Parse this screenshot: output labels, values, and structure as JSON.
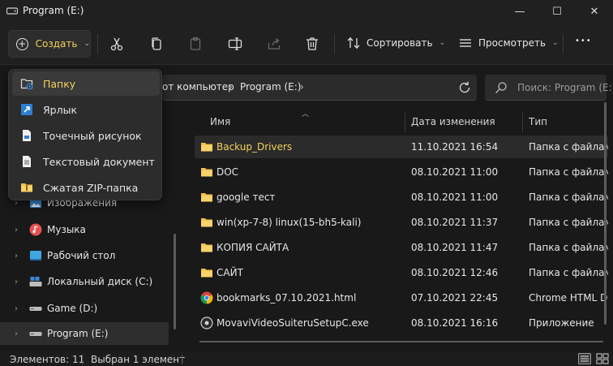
{
  "window": {
    "title": "Program (E:)",
    "minimize": "—",
    "maximize": "☐",
    "close": "✕"
  },
  "toolbar": {
    "create_label": "Создать",
    "sort_label": "Сортировать",
    "view_label": "Просмотреть",
    "more": "•••"
  },
  "dropdown": {
    "items": [
      {
        "label": "Папку",
        "icon": "new-folder-icon"
      },
      {
        "label": "Ярлык",
        "icon": "shortcut-icon"
      },
      {
        "label": "Точечный рисунок",
        "icon": "bitmap-icon"
      },
      {
        "label": "Текстовый документ",
        "icon": "text-document-icon"
      },
      {
        "label": "Сжатая ZIP-папка",
        "icon": "zip-folder-icon"
      }
    ]
  },
  "address": {
    "crumb1": "от компьютер",
    "crumb2": "Program (E:)",
    "sep": "›"
  },
  "search": {
    "placeholder": "Поиск: Program (E:)"
  },
  "nav": {
    "items": [
      {
        "label": "Изображения",
        "icon": "pictures-icon"
      },
      {
        "label": "Музыка",
        "icon": "music-icon"
      },
      {
        "label": "Рабочий стол",
        "icon": "desktop-icon"
      },
      {
        "label": "Локальный диск (C:)",
        "icon": "drive-c-icon"
      },
      {
        "label": "Game (D:)",
        "icon": "drive-d-icon"
      },
      {
        "label": "Program (E:)",
        "icon": "drive-e-icon"
      }
    ]
  },
  "columns": {
    "name": "Имя",
    "date": "Дата изменения",
    "type": "Тип"
  },
  "files": [
    {
      "name": "Backup_Drivers",
      "date": "11.10.2021 16:54",
      "type": "Папка с файлами",
      "icon": "folder-icon"
    },
    {
      "name": "DOC",
      "date": "08.10.2021 11:00",
      "type": "Папка с файлами",
      "icon": "folder-icon"
    },
    {
      "name": "google тест",
      "date": "08.10.2021 11:00",
      "type": "Папка с файлами",
      "icon": "folder-icon"
    },
    {
      "name": "win(xp-7-8) linux(15-bh5-kali)",
      "date": "08.10.2021 11:37",
      "type": "Папка с файлами",
      "icon": "folder-icon"
    },
    {
      "name": "КОПИЯ САЙТА",
      "date": "08.10.2021 11:47",
      "type": "Папка с файлами",
      "icon": "folder-icon"
    },
    {
      "name": "САЙТ",
      "date": "08.10.2021 12:46",
      "type": "Папка с файлами",
      "icon": "folder-icon"
    },
    {
      "name": "bookmarks_07.10.2021.html",
      "date": "07.10.2021 22:45",
      "type": "Chrome HTML Document",
      "icon": "chrome-icon"
    },
    {
      "name": "MovaviVideoSuiteruSetupC.exe",
      "date": "08.10.2021 16:16",
      "type": "Приложение",
      "icon": "exe-icon"
    }
  ],
  "status": {
    "count": "Элементов: 11",
    "selected": "Выбран 1 элемент"
  }
}
